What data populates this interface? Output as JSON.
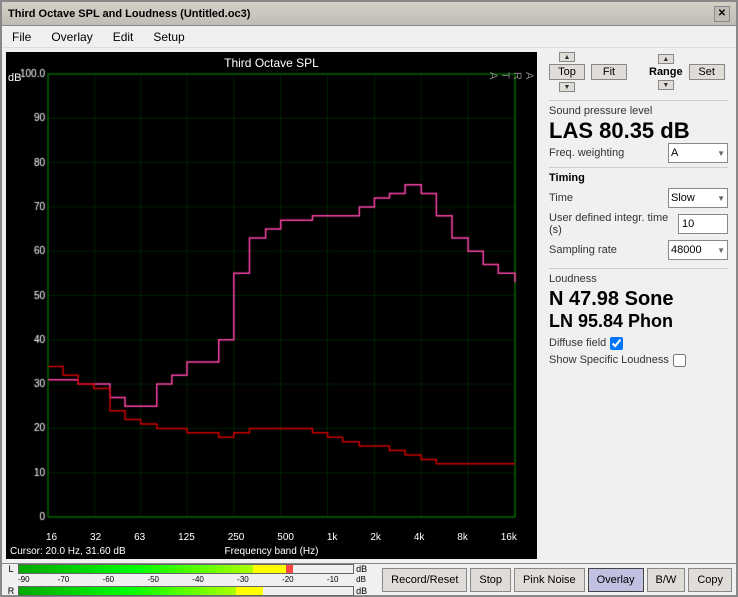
{
  "window": {
    "title": "Third Octave SPL and Loudness (Untitled.oc3)"
  },
  "menu": {
    "items": [
      "File",
      "Overlay",
      "Edit",
      "Setup"
    ]
  },
  "chart": {
    "title": "Third Octave SPL",
    "arta_label": "A\nR\nT\nA",
    "y_label": "dB",
    "y_max": "100.0",
    "x_labels": [
      "16",
      "32",
      "63",
      "125",
      "250",
      "500",
      "1k",
      "2k",
      "4k",
      "8k",
      "16k"
    ],
    "x_title": "Frequency band (Hz)",
    "cursor_info": "Cursor:  20.0 Hz, 31.60 dB"
  },
  "top_controls": {
    "top_label": "Top",
    "fit_label": "Fit",
    "range_label": "Range",
    "set_label": "Set"
  },
  "spl": {
    "section_label": "Sound pressure level",
    "value": "LAS 80.35 dB",
    "freq_weighting_label": "Freq. weighting",
    "freq_weighting_value": "A"
  },
  "timing": {
    "section_label": "Timing",
    "time_label": "Time",
    "time_value": "Slow",
    "user_defined_label": "User defined integr. time (s)",
    "user_defined_value": "10",
    "sampling_rate_label": "Sampling rate",
    "sampling_rate_value": "48000"
  },
  "loudness": {
    "section_label": "Loudness",
    "n_value": "N 47.98 Sone",
    "ln_value": "LN 95.84 Phon",
    "diffuse_field_label": "Diffuse field",
    "diffuse_field_checked": true,
    "show_specific_label": "Show Specific Loudness",
    "show_specific_checked": false
  },
  "bottom_buttons": {
    "record_reset": "Record/Reset",
    "stop": "Stop",
    "pink_noise": "Pink Noise",
    "overlay": "Overlay",
    "bw": "B/W",
    "copy": "Copy"
  },
  "level_meter": {
    "left_label": "L",
    "right_label": "R",
    "ticks": [
      "-90",
      "-70",
      "-60",
      "-50",
      "-40",
      "-30",
      "-20",
      "-10",
      "dB"
    ]
  }
}
